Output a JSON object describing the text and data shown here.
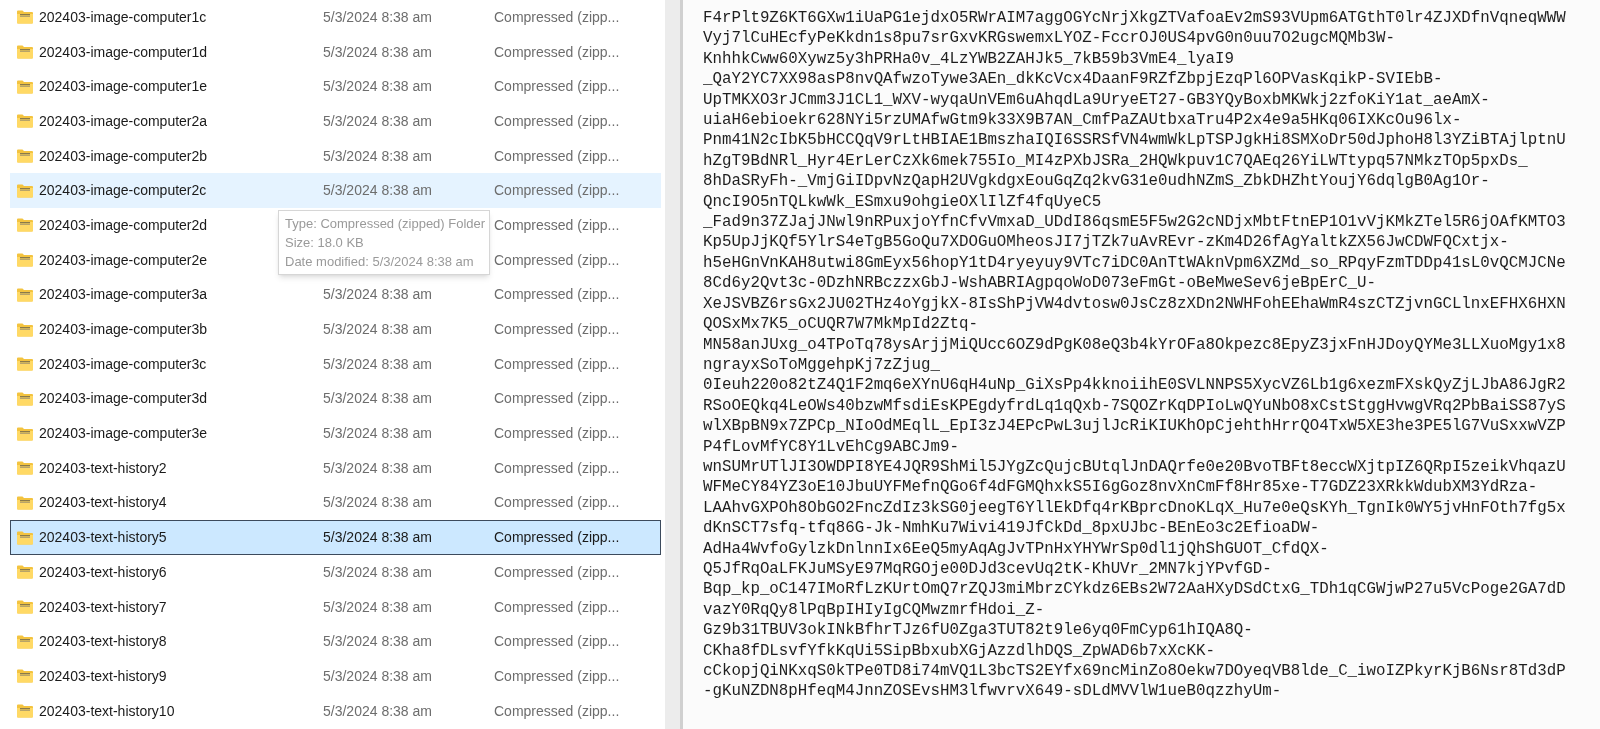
{
  "file_list": {
    "rows": [
      {
        "name": "202403-image-computer1c",
        "date": "5/3/2024 8:38 am",
        "type": "Compressed (zipp...",
        "selected": false,
        "hovered": false
      },
      {
        "name": "202403-image-computer1d",
        "date": "5/3/2024 8:38 am",
        "type": "Compressed (zipp...",
        "selected": false,
        "hovered": false
      },
      {
        "name": "202403-image-computer1e",
        "date": "5/3/2024 8:38 am",
        "type": "Compressed (zipp...",
        "selected": false,
        "hovered": false
      },
      {
        "name": "202403-image-computer2a",
        "date": "5/3/2024 8:38 am",
        "type": "Compressed (zipp...",
        "selected": false,
        "hovered": false
      },
      {
        "name": "202403-image-computer2b",
        "date": "5/3/2024 8:38 am",
        "type": "Compressed (zipp...",
        "selected": false,
        "hovered": false
      },
      {
        "name": "202403-image-computer2c",
        "date": "5/3/2024 8:38 am",
        "type": "Compressed (zipp...",
        "selected": false,
        "hovered": true
      },
      {
        "name": "202403-image-computer2d",
        "type": "Compressed (zipp...",
        "selected": false,
        "hovered": false
      },
      {
        "name": "202403-image-computer2e",
        "type": "Compressed (zipp...",
        "selected": false,
        "hovered": false
      },
      {
        "name": "202403-image-computer3a",
        "date": "5/3/2024 8:38 am",
        "type": "Compressed (zipp...",
        "selected": false,
        "hovered": false
      },
      {
        "name": "202403-image-computer3b",
        "date": "5/3/2024 8:38 am",
        "type": "Compressed (zipp...",
        "selected": false,
        "hovered": false
      },
      {
        "name": "202403-image-computer3c",
        "date": "5/3/2024 8:38 am",
        "type": "Compressed (zipp...",
        "selected": false,
        "hovered": false
      },
      {
        "name": "202403-image-computer3d",
        "date": "5/3/2024 8:38 am",
        "type": "Compressed (zipp...",
        "selected": false,
        "hovered": false
      },
      {
        "name": "202403-image-computer3e",
        "date": "5/3/2024 8:38 am",
        "type": "Compressed (zipp...",
        "selected": false,
        "hovered": false
      },
      {
        "name": "202403-text-history2",
        "date": "5/3/2024 8:38 am",
        "type": "Compressed (zipp...",
        "selected": false,
        "hovered": false
      },
      {
        "name": "202403-text-history4",
        "date": "5/3/2024 8:38 am",
        "type": "Compressed (zipp...",
        "selected": false,
        "hovered": false
      },
      {
        "name": "202403-text-history5",
        "date": "5/3/2024 8:38 am",
        "type": "Compressed (zipp...",
        "selected": true,
        "hovered": false
      },
      {
        "name": "202403-text-history6",
        "date": "5/3/2024 8:38 am",
        "type": "Compressed (zipp...",
        "selected": false,
        "hovered": false
      },
      {
        "name": "202403-text-history7",
        "date": "5/3/2024 8:38 am",
        "type": "Compressed (zipp...",
        "selected": false,
        "hovered": false
      },
      {
        "name": "202403-text-history8",
        "date": "5/3/2024 8:38 am",
        "type": "Compressed (zipp...",
        "selected": false,
        "hovered": false
      },
      {
        "name": "202403-text-history9",
        "date": "5/3/2024 8:38 am",
        "type": "Compressed (zipp...",
        "selected": false,
        "hovered": false
      },
      {
        "name": "202403-text-history10",
        "date": "5/3/2024 8:38 am",
        "type": "Compressed (zipp...",
        "selected": false,
        "hovered": false
      }
    ]
  },
  "tooltip": {
    "lines": [
      "Type: Compressed (zipped) Folder",
      "Size: 18.0 KB",
      "Date modified: 5/3/2024 8:38 am"
    ]
  },
  "text_view": {
    "lines": [
      "F4rPlt9Z6KT6GXw1iUaPG1ejdxO5RWrAIM7aggOGYcNrjXkgZTVafoaEv2mS93VUpm6ATGthT0lr4ZJXDfnVqneqWWW",
      "Vyj7lCuHEcfyPeKkdn1s8pu7srGxvKRGswemxLYOZ-FccrOJ0US4pvG0n0uu7O2ugcMQMb3W-",
      "KnhhkCww60Xywz5y3hPRHa0v_4LzYWB2ZAHJk5_7kB59b3VmE4_lyaI9",
      "_QaY2YC7XX98asP8nvQAfwzoTywe3AEn_dkKcVcx4DaanF9RZfZbpjEzqPl6OPVasKqikP-SVIEbB-",
      "UpTMKXO3rJCmm3J1CL1_WXV-wyqaUnVEm6uAhqdLa9UryeET27-GB3YQyBoxbMKWkj2zfoKiY1at_aeAmX-",
      "uiaH6ebioekr628NYi5rzUMAfwGtm9k33X9B7AN_CmfPaZAUtbxaTru4P2x4e9a5HKq06IXKcOu96lx-",
      "Pnm41N2cIbK5bHCCQqV9rLtHBIAE1BmszhaIQI6SSRSfVN4wmWkLpTSPJgkHi8SMXoDr50dJphoH8l3YZiBTAjlptnU",
      "hZgT9BdNRl_Hyr4ErLerCzXk6mek755Io_MI4zPXbJSRa_2HQWkpuv1C7QAEq26YiLWTtypq57NMkzTOp5pxDs_",
      "8hDaSRyFh-_VmjGiIDpvNzQapH2UVgkdgxEouGqZq2kvG31e0udhNZmS_ZbkDHZhtYoujY6dqlgB0Ag1Or-",
      "QncI9O5nTQLkwWk_ESmxu9ohgieOXlIlZf4fqUyeC5",
      "_Fad9n37ZJajJNwl9nRPuxjoYfnCfvVmxaD_UDdI86qsmE5F5w2G2cNDjxMbtFtnEP1O1vVjKMkZTel5R6jOAfKMTO3",
      "Kp5UpJjKQf5YlrS4eTgB5GoQu7XDOGuOMheosJI7jTZk7uAvREvr-zKm4D26fAgYaltkZX56JwCDWFQCxtjx-",
      "h5eHGnVnKAH8utwi8GmEyx56hopY1tD4ryeyuy9VTc7iDC0AnTtWAknVpm6XZMd_so_RPqyFzmTDDp41sL0vQCMJCNe",
      "8Cd6y2Qvt3c-0DzhNRBczzxGbJ-WshABRIAgpqoWoD073eFmGt-oBeMweSev6jeBpErC_U-",
      "XeJSVBZ6rsGx2JU02THz4oYgjkX-8IsShPjVW4dvtosw0JsCz8zXDn2NWHFohEEhaWmR4szCTZjvnGCLlnxEFHX6HXN",
      "QOSxMx7K5_oCUQR7W7MkMpId2Ztq-",
      "MN58anJUxg_o4TPoTq78ysArjjMiQUcc6OZ9dPgK08eQ3b4kYrOFa8Okpezc8EpyZ3jxFnHJDoyQYMe3LLXuoMgy1x8",
      "ngrayxSoToMggehpKj7zZjug_",
      "0Ieuh220o82tZ4Q1F2mq6eXYnU6qH4uNp_GiXsPp4kknoiihE0SVLNNPS5XycVZ6Lb1g6xezmFXskQyZjLJbA86JgR2",
      "RSoOEQkq4LeOWs40bzwMfsdiEsKPEgdyfrdLq1qQxb-7SQOZrKqDPIoLwQYuNbO8xCstStggHvwgVRq2PbBaiSS87yS",
      "wlXBpBN9x7ZPCp_NIoOdMEqlL_EpI3zJ4EPcPwL3ujlJcRiKIUKhOpCjehthHrrQO4TxW5XE3he3PE5lG7VuSxxwVZP",
      "P4fLovMfYC8Y1LvEhCg9ABCJm9-",
      "wnSUMrUTlJI3OWDPI8YE4JQR9ShMil5JYgZcQujcBUtqlJnDAQrfe0e20BvoTBFt8eccWXjtpIZ6QRpI5zeikVhqazU",
      "WFMeCY84YZ3oE10JbuUYFMefnQGo6f4dFGMQhxkS5I6gGoz8nvXnCmFf8Hr85xe-T7GDZ23XRkkWdubXM3YdRza-",
      "LAAhvGXPOh8ObGO2FncZdIz3kSG0jeegT6YllEkDfq4rKBprcDnoKLqX_Hu7e0eQsKYh_TgnIk0WY5jvHnFOth7fg5x",
      "dKnSCT7sfq-tfq86G-Jk-NmhKu7Wivi419JfCkDd_8pxUJbc-BEnEo3c2EfioaDW-",
      "AdHa4WvfoGylzkDnlnnIx6EeQ5myAqAgJvTPnHxYHYWrSp0dl1jQhShGUOT_CfdQX-",
      "Q5JfRqOaLFKJuMSyE97MqRGOje00DJd3cevUq2tK-KhUVr_2MN7kjYPvfGD-",
      "Bqp_kp_oC147IMoRfLzKUrtOmQ7rZQJ3miMbrzCYkdz6EBs2W72AaHXyDSdCtxG_TDh1qCGWjwP27u5VcPoge2GA7dD",
      "vazY0RqQy8lPqBpIHIyIgCQMwzmrfHdoi_Z-",
      "Gz9b31TBUV3okINkBfhrTJz6fU0Zga3TUT82t9le6yq0FmCyp61hIQA8Q-",
      "CKha8fDLsvfYfkKqUi5SipBbxubXGjAzzdlhDQS_ZpWAD6b7xXcKK-",
      "cCkopjQiNKxqS0kTPe0TD8i74mVQ1L3bcTS2EYfx69ncMinZo8Oekw7DOyeqVB8lde_C_iwoIZPkyrKjB6Nsr8Td3dP",
      "-gKuNZDN8pHfeqM4JnnZOSEvsHM3lfwvrvX649-sDLdMVVlW1ueB0qzzhyUm-"
    ]
  }
}
